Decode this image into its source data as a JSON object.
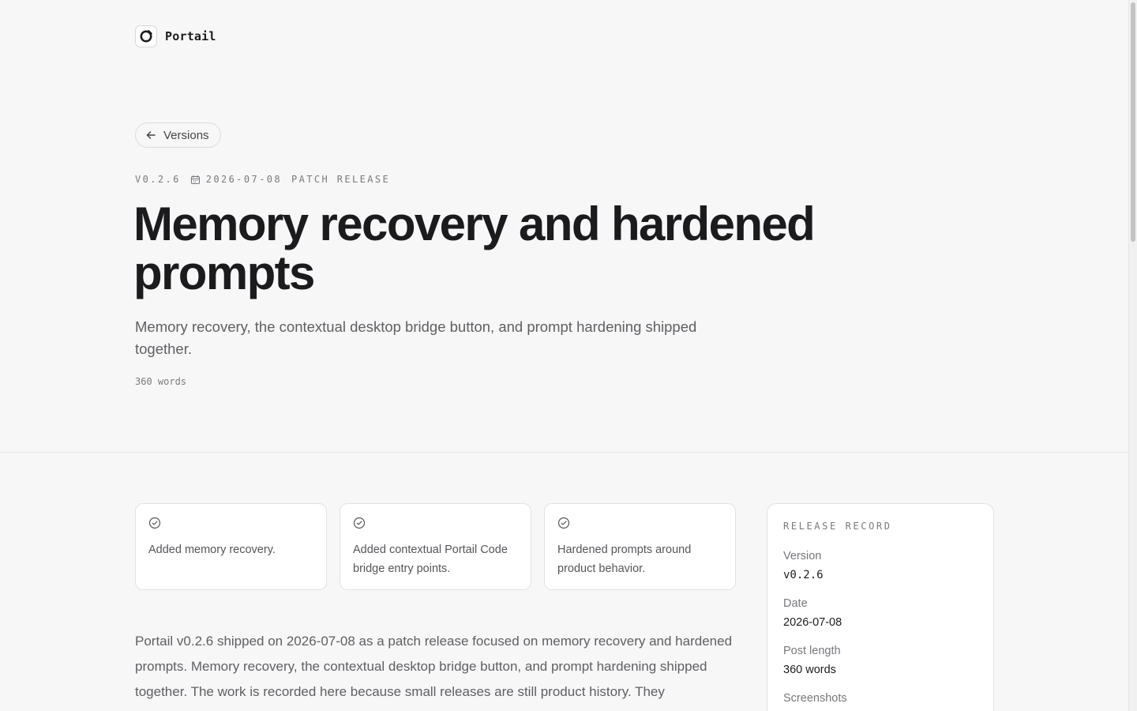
{
  "brand": {
    "name": "Portail",
    "logo_icon": "portail-logo-icon"
  },
  "nav": {
    "back_label": "Versions",
    "back_icon": "arrow-left-icon"
  },
  "release": {
    "version": "V0.2.6",
    "date": "2026-07-08",
    "date_icon": "calendar-icon",
    "type": "PATCH RELEASE",
    "title": "Memory recovery and hardened prompts",
    "subtitle": "Memory recovery, the contextual desktop bridge button, and prompt hardening shipped together.",
    "word_count": "360 words"
  },
  "highlights": [
    {
      "icon": "check-circle-icon",
      "text": "Added memory recovery."
    },
    {
      "icon": "check-circle-icon",
      "text": "Added contextual Portail Code bridge entry points."
    },
    {
      "icon": "check-circle-icon",
      "text": "Hardened prompts around product behavior."
    }
  ],
  "body": {
    "paragraph": "Portail v0.2.6 shipped on 2026-07-08 as a patch release focused on memory recovery and hardened prompts. Memory recovery, the contextual desktop bridge button, and prompt hardening shipped together. The work is recorded here because small releases are still product history. They"
  },
  "record": {
    "heading": "RELEASE RECORD",
    "rows": [
      {
        "label": "Version",
        "value": "v0.2.6"
      },
      {
        "label": "Date",
        "value": "2026-07-08"
      },
      {
        "label": "Post length",
        "value": "360 words"
      },
      {
        "label": "Screenshots",
        "value": ""
      }
    ]
  },
  "colors": {
    "background": "#f7f7f7",
    "text": "#1c1c1e",
    "muted": "#5f5f64",
    "border": "#e2e2e4"
  }
}
